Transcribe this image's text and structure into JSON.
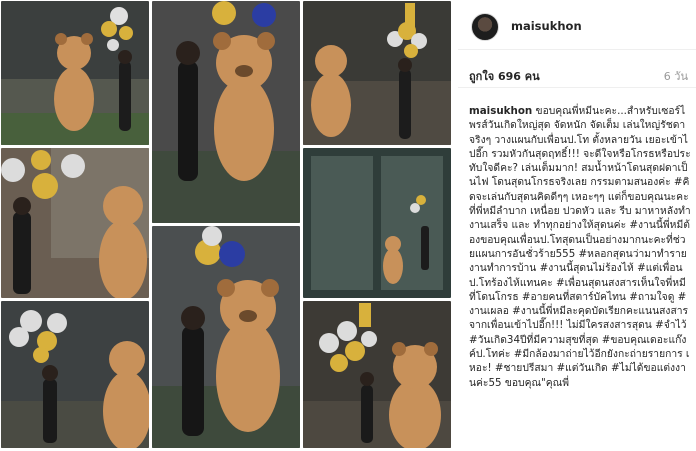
{
  "post": {
    "username": "maisukhon",
    "likes": "ถูกใจ 696 คน",
    "time": "6 วัน",
    "caption_user": "maisukhon",
    "caption_body": "ขอบคุณพี่หมีนะคะ...สำหรับเซอร์ไพรส์วันเกิดใหญ่สุด จัดหนัก จัดเต็ม เล่นใหญ่รัชดาจริงๆ วางแผนกับเพื่อนป.โท ตั้งหลายวัน เยอะเข้าไปอี๊ก รวมหัวกันสุดฤทธิ์!!! จะดีใจหรือโกรธหรือประทับใจดีคะ? เล่นเต็มมาก! สมน้ำหน้าโดนสุดฝดาเป็นไฟ โดนสุดนโกรธจริงเลย กรรมตามสนองค่ะ #คิดจะเล่นกับสุดนคิดดีๆๆ เหอะๆๆ แต่ก็ขอบคุณนะคะที่พี่หมีลำบาก เหนื่อย ปวดหัว และ รีบ มาหาหลังทำงานเสร็จ และ ทำทุกอย่างให้สุดนค่ะ #งานนี้พี่หมีต้องขอบคุณเพื่อนป.โทสุดนเป็นอย่างมากนะคะที่ช่วยแผนการอันชั่วร้าย555 #หลอกสุดนว่ามาทำรายงานทำการบ้าน #งานนี้สุดนไม่ร้องไห้ #แต่เพื่อนป.โทร้องไห้แทนคะ #เพื่อนสุดนสงสารเห็นใจพี่หมีที่โดนโกรธ #อายคนที่สตาร์บัคไทน #ถามใจดู #งานเผลอ #งานนี้พี่หมีละคุดบัดเรียกคะแนนสงสารจากเพื่อนเข้าไปอี๊ก!!! ไม่มีใครสงสารสุดน #จำไว้ #วันเกิด34ปีที่มีความสุขที่สุด #ขอบคุณเดอะแก๊งค์ป.โทค่ะ #มีกล้องมาถ่ายไว้อีกยังกะถ่ายรายการ เหอะ! #ชายปรีสมา #แต่วันเกิด #ไม่ได้ขอแต่งงานค่ะ55 ขอบคุณ\"คุณพี่"
  },
  "photos": [
    {
      "name": "photo-1",
      "bg": "#3b3f3e",
      "accent": "#d9b84a"
    },
    {
      "name": "photo-2",
      "bg": "#4a4a4a",
      "accent": "#2f3fa8"
    },
    {
      "name": "photo-3",
      "bg": "#3a3a36",
      "accent": "#d4b23c"
    },
    {
      "name": "photo-4",
      "bg": "#6a5e52",
      "accent": "#c9a83a"
    },
    {
      "name": "photo-5",
      "bg": "#4b4f50",
      "accent": "#d8b43f"
    },
    {
      "name": "photo-6",
      "bg": "#2f3d3a",
      "accent": "#e0e0e0"
    },
    {
      "name": "photo-7",
      "bg": "#3d4142",
      "accent": "#d6b13f"
    },
    {
      "name": "photo-8",
      "bg": "#3e3e3e",
      "accent": "#2c3ca0"
    },
    {
      "name": "photo-9",
      "bg": "#3d3a35",
      "accent": "#d9b23c"
    }
  ],
  "colors": {
    "bear": "#c8915a",
    "bear_dark": "#a06c3c",
    "balloon_gold": "#d8b13c",
    "balloon_silver": "#dcdcdc",
    "balloon_blue": "#2b3da3"
  }
}
